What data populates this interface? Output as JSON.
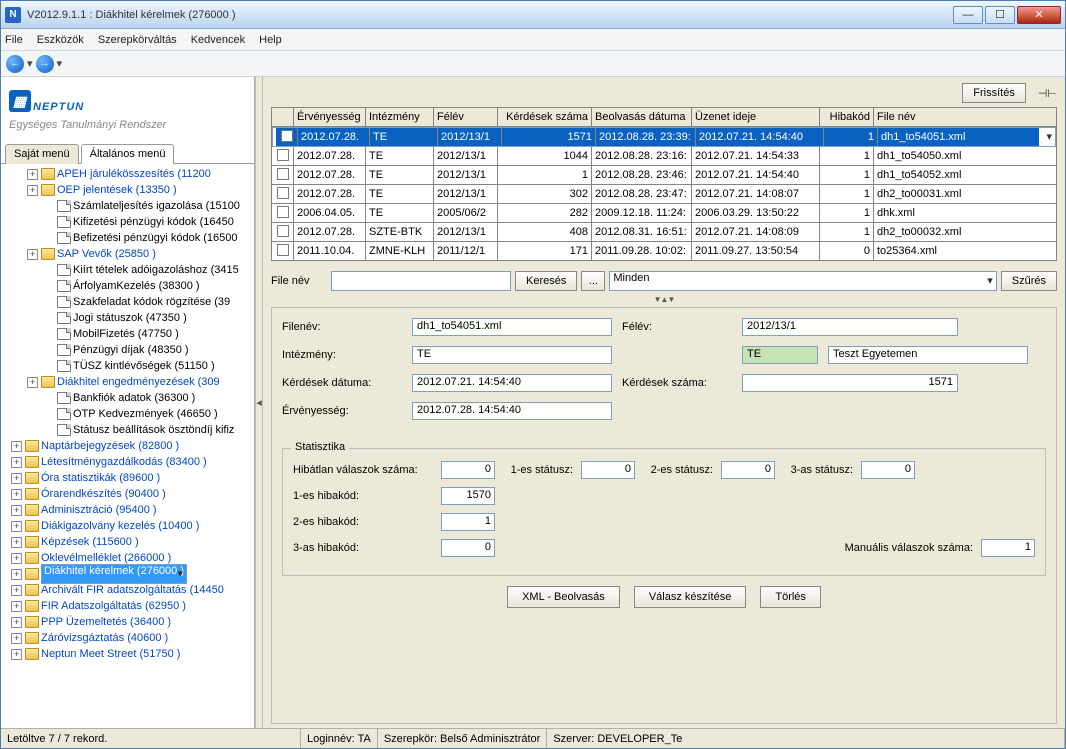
{
  "window": {
    "title": "V2012.9.1.1 : Diákhitel kérelmek (276000  )"
  },
  "menu": [
    "File",
    "Eszközök",
    "Szerepkörváltás",
    "Kedvencek",
    "Help"
  ],
  "logo": {
    "brand": "NEPTUN",
    "sub": "Egységes Tanulmányi Rendszer"
  },
  "tabs": {
    "own": "Saját menü",
    "general": "Általános menü"
  },
  "tree": [
    {
      "d": 1,
      "exp": "+",
      "icon": "folder",
      "link": true,
      "text": "APEH járulékösszesítés (11200"
    },
    {
      "d": 1,
      "exp": "+",
      "icon": "folder",
      "link": true,
      "text": "OEP jelentések (13350  )"
    },
    {
      "d": 2,
      "exp": "",
      "icon": "doc",
      "link": false,
      "text": "Számlateljesítés igazolása (15100"
    },
    {
      "d": 2,
      "exp": "",
      "icon": "doc",
      "link": false,
      "text": "Kifizetési pénzügyi kódok (16450"
    },
    {
      "d": 2,
      "exp": "",
      "icon": "doc",
      "link": false,
      "text": "Befizetési pénzügyi kódok (16500"
    },
    {
      "d": 1,
      "exp": "+",
      "icon": "folder",
      "link": true,
      "text": "SAP Vevők (25850  )"
    },
    {
      "d": 2,
      "exp": "",
      "icon": "doc",
      "link": false,
      "text": "Kiírt tételek adóigazoláshoz (3415"
    },
    {
      "d": 2,
      "exp": "",
      "icon": "doc",
      "link": false,
      "text": "ÁrfolyamKezelés (38300  )"
    },
    {
      "d": 2,
      "exp": "",
      "icon": "doc",
      "link": false,
      "text": "Szakfeladat kódok rögzítése (39"
    },
    {
      "d": 2,
      "exp": "",
      "icon": "doc",
      "link": false,
      "text": "Jogi státuszok (47350  )"
    },
    {
      "d": 2,
      "exp": "",
      "icon": "doc",
      "link": false,
      "text": "MobilFizetés (47750  )"
    },
    {
      "d": 2,
      "exp": "",
      "icon": "doc",
      "link": false,
      "text": "Pénzügyi díjak (48350  )"
    },
    {
      "d": 2,
      "exp": "",
      "icon": "doc",
      "link": false,
      "text": "TÜSZ kintlévőségek (51150  )"
    },
    {
      "d": 1,
      "exp": "+",
      "icon": "folder",
      "link": true,
      "text": "Diákhitel engedményezések (309"
    },
    {
      "d": 2,
      "exp": "",
      "icon": "doc",
      "link": false,
      "text": "Bankfiók adatok (36300  )"
    },
    {
      "d": 2,
      "exp": "",
      "icon": "doc",
      "link": false,
      "text": "OTP Kedvezmények (46650  )"
    },
    {
      "d": 2,
      "exp": "",
      "icon": "doc",
      "link": false,
      "text": "Státusz beállítások ösztöndíj kifiz"
    },
    {
      "d": 0,
      "exp": "+",
      "icon": "folder",
      "link": true,
      "text": "Naptárbejegyzések (82800  )"
    },
    {
      "d": 0,
      "exp": "+",
      "icon": "folder",
      "link": true,
      "text": "Létesítménygazdálkodás (83400  )"
    },
    {
      "d": 0,
      "exp": "+",
      "icon": "folder",
      "link": true,
      "text": "Óra statisztikák (89600  )"
    },
    {
      "d": 0,
      "exp": "+",
      "icon": "folder",
      "link": true,
      "text": "Órarendkészítés (90400  )"
    },
    {
      "d": 0,
      "exp": "+",
      "icon": "folder",
      "link": true,
      "text": "Adminisztráció (95400  )"
    },
    {
      "d": 0,
      "exp": "+",
      "icon": "folder",
      "link": true,
      "text": "Diákigazolvány kezelés (10400  )"
    },
    {
      "d": 0,
      "exp": "+",
      "icon": "folder",
      "link": true,
      "text": "Képzések (115600  )"
    },
    {
      "d": 0,
      "exp": "+",
      "icon": "folder",
      "link": true,
      "text": "Oklevélmelléklet (266000  )"
    },
    {
      "d": 0,
      "exp": "+",
      "icon": "folder",
      "link": true,
      "sel": true,
      "text": "Diákhitel kérelmek (276000  )"
    },
    {
      "d": 0,
      "exp": "+",
      "icon": "folder",
      "link": true,
      "text": "Archivált FIR adatszolgáltatás (14450"
    },
    {
      "d": 0,
      "exp": "+",
      "icon": "folder",
      "link": true,
      "text": "FIR Adatszolgáltatás (62950  )"
    },
    {
      "d": 0,
      "exp": "+",
      "icon": "folder",
      "link": true,
      "text": "PPP Üzemeltetés (36400  )"
    },
    {
      "d": 0,
      "exp": "+",
      "icon": "folder",
      "link": true,
      "text": "Záróvizsgáztatás (40600  )"
    },
    {
      "d": 0,
      "exp": "+",
      "icon": "folder",
      "link": true,
      "text": "Neptun Meet Street (51750  )"
    }
  ],
  "topButtons": {
    "refresh": "Frissítés"
  },
  "gridHeaders": [
    "",
    "Érvényesség",
    "Intézmény",
    "Félév",
    "Kérdések száma",
    "Beolvasás dátuma",
    "Üzenet ideje",
    "Hibakód",
    "File név"
  ],
  "gridRows": [
    {
      "sel": true,
      "c": [
        "2012.07.28.",
        "TE",
        "2012/13/1",
        "1571",
        "2012.08.28. 23:39:",
        "2012.07.21. 14:54:40",
        "1",
        "dh1_to54051.xml"
      ]
    },
    {
      "c": [
        "2012.07.28.",
        "TE",
        "2012/13/1",
        "1044",
        "2012.08.28. 23:16:",
        "2012.07.21. 14:54:33",
        "1",
        "dh1_to54050.xml"
      ]
    },
    {
      "c": [
        "2012.07.28.",
        "TE",
        "2012/13/1",
        "1",
        "2012.08.28. 23:46:",
        "2012.07.21. 14:54:40",
        "1",
        "dh1_to54052.xml"
      ]
    },
    {
      "c": [
        "2012.07.28.",
        "TE",
        "2012/13/1",
        "302",
        "2012.08.28. 23:47:",
        "2012.07.21. 14:08:07",
        "1",
        "dh2_to00031.xml"
      ]
    },
    {
      "c": [
        "2006.04.05.",
        "TE",
        "2005/06/2",
        "282",
        "2009.12.18. 11:24:",
        "2006.03.29. 13:50:22",
        "1",
        "dhk.xml"
      ]
    },
    {
      "c": [
        "2012.07.28.",
        "SZTE-BTK",
        "2012/13/1",
        "408",
        "2012.08.31. 16:51:",
        "2012.07.21. 14:08:09",
        "1",
        "dh2_to00032.xml"
      ]
    },
    {
      "c": [
        "2011.10.04.",
        "ZMNE-KLH",
        "2011/12/1",
        "171",
        "2011.09.28. 10:02:",
        "2011.09.27. 13:50:54",
        "0",
        "to25364.xml"
      ]
    }
  ],
  "filter": {
    "label": "File név",
    "search": "Keresés",
    "browse": "...",
    "sel": "Minden",
    "filterBtn": "Szűrés"
  },
  "form": {
    "labels": {
      "filename": "Filenév:",
      "semester": "Félév:",
      "inst": "Intézmény:",
      "qdate": "Kérdések dátuma:",
      "qcount": "Kérdések száma:",
      "valid": "Érvényesség:"
    },
    "values": {
      "filename": "dh1_to54051.xml",
      "semester": "2012/13/1",
      "instCode": "TE",
      "instName": "Teszt Egyetemen",
      "qdate": "2012.07.21. 14:54:40",
      "qcount": "1571",
      "valid": "2012.07.28. 14:54:40"
    }
  },
  "stat": {
    "legend": "Statisztika",
    "labels": {
      "hibatlan": "Hibátlan válaszok száma:",
      "s1": "1-es státusz:",
      "s2": "2-es státusz:",
      "s3": "3-as státusz:",
      "e1": "1-es hibakód:",
      "e2": "2-es hibakód:",
      "e3": "3-as hibakód:",
      "manual": "Manuális válaszok száma:"
    },
    "values": {
      "hibatlan": "0",
      "s1": "0",
      "s2": "0",
      "s3": "0",
      "e1": "1570",
      "e2": "1",
      "e3": "0",
      "manual": "1"
    }
  },
  "actions": {
    "xml": "XML - Beolvasás",
    "answer": "Válasz készítése",
    "delete": "Törlés"
  },
  "status": {
    "records": "Letöltve 7 / 7 rekord.",
    "login": "Loginnév: TA",
    "role": "Szerepkör: Belső Adminisztrátor",
    "server": "Szerver: DEVELOPER_Te"
  }
}
